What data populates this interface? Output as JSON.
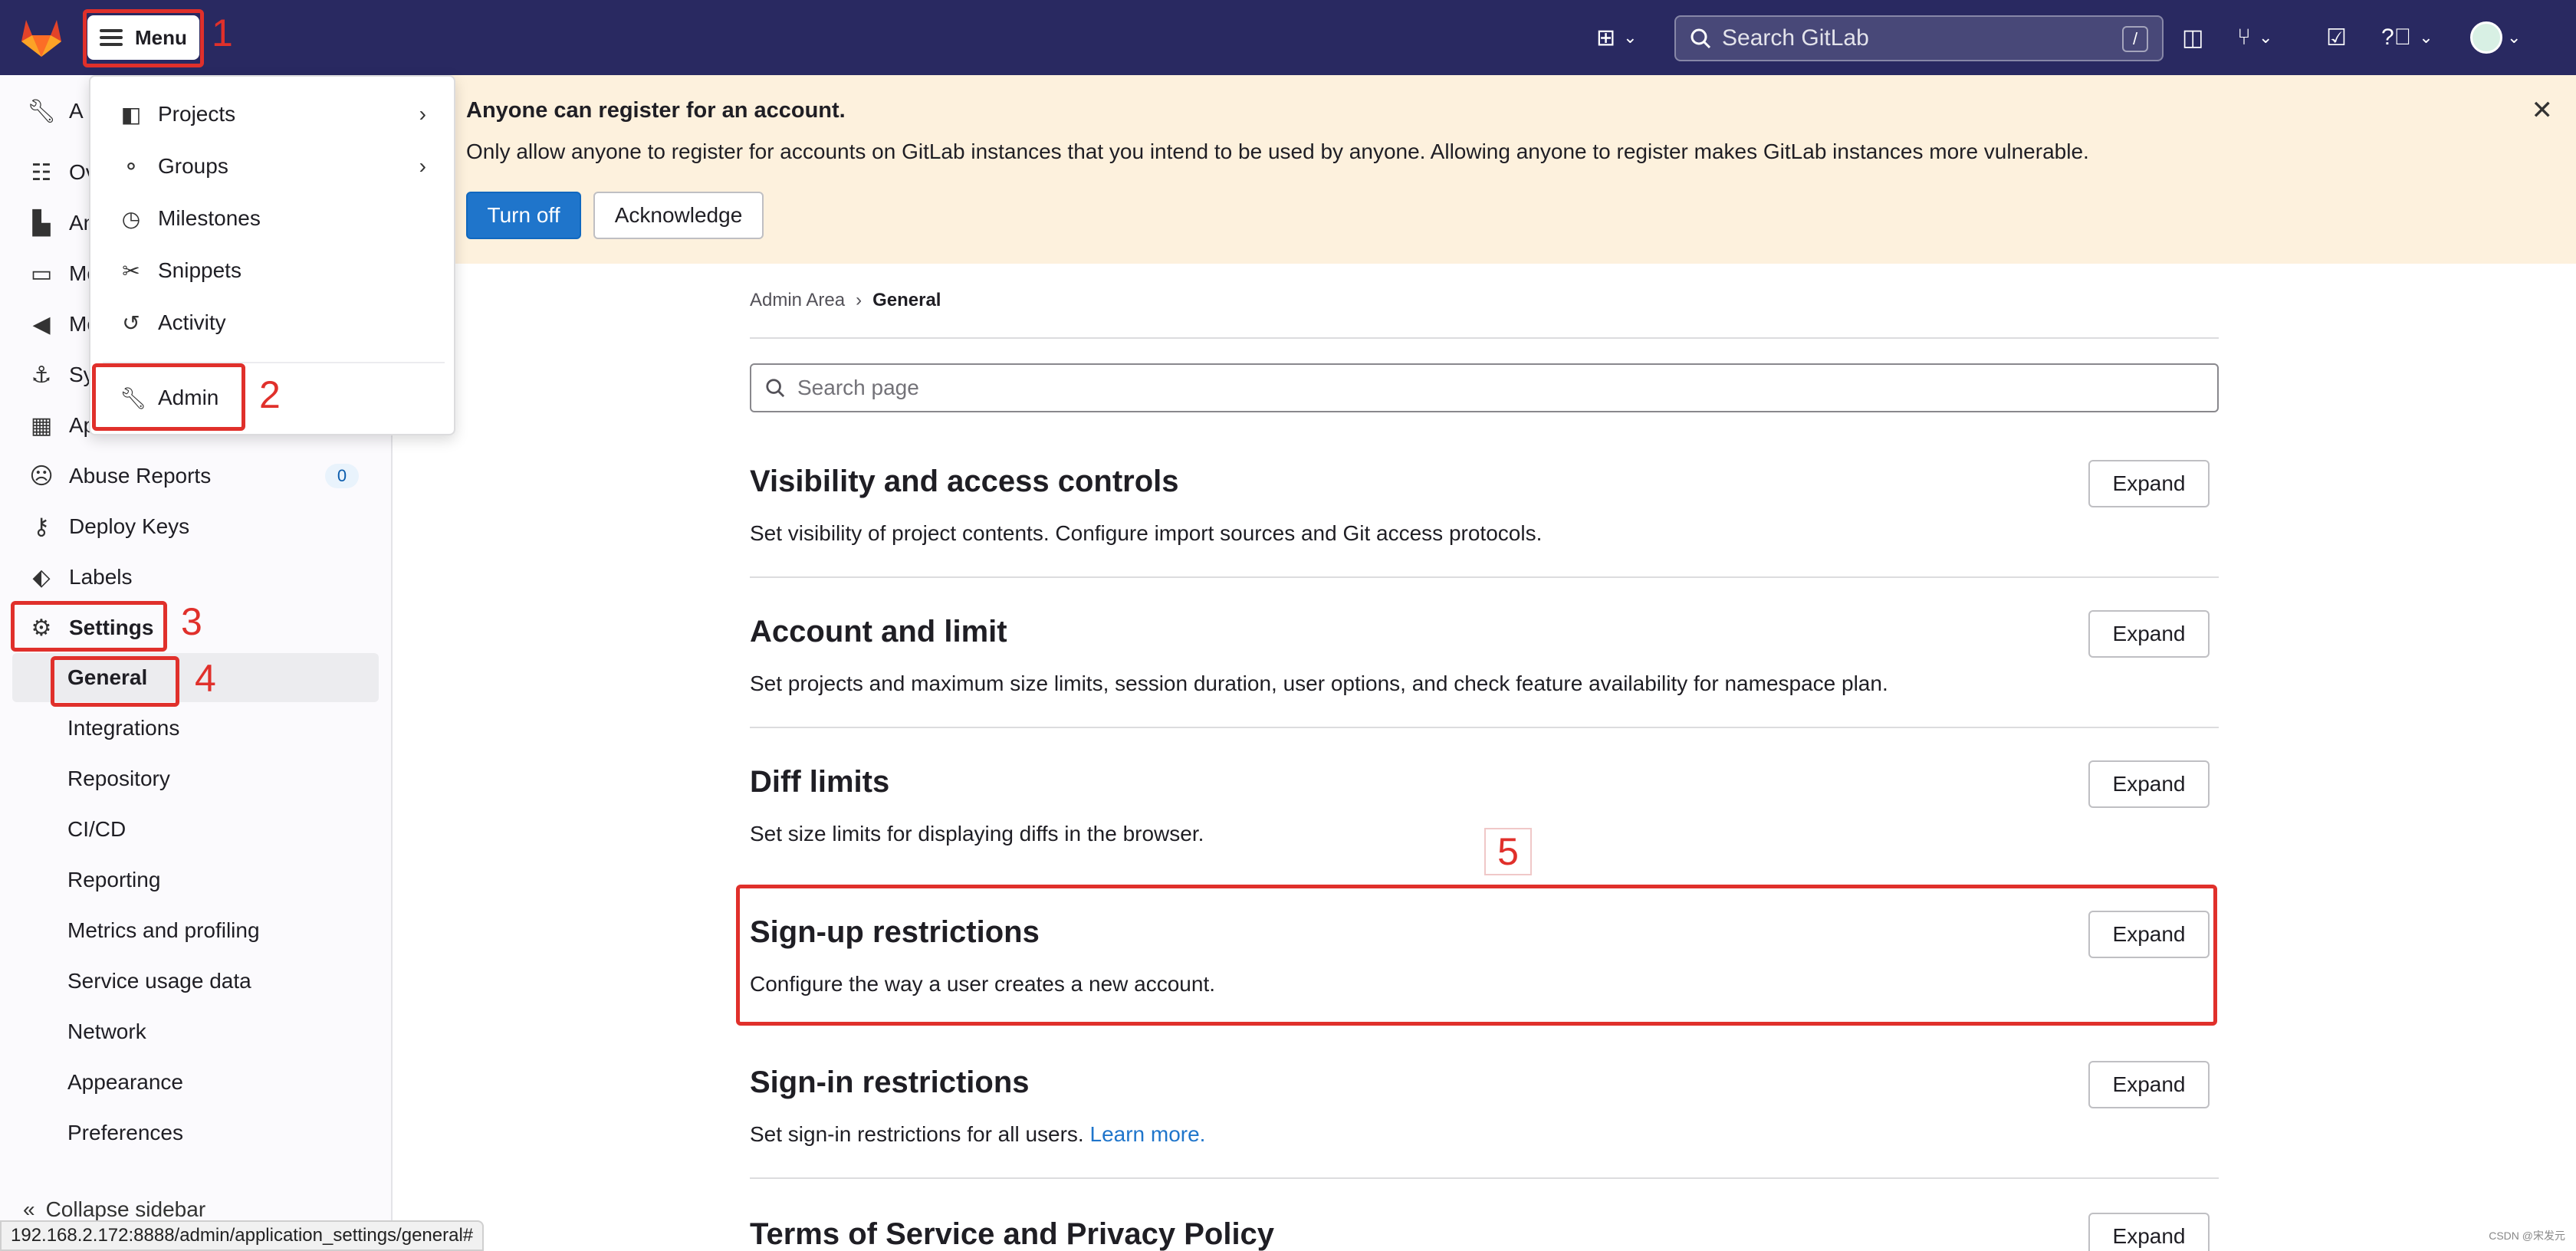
{
  "topbar": {
    "menu_label": "Menu",
    "search_placeholder": "Search GitLab",
    "search_shortcut": "/"
  },
  "dropdown": {
    "items": [
      {
        "label": "Projects",
        "icon": "project-icon",
        "has_submenu": true
      },
      {
        "label": "Groups",
        "icon": "group-icon",
        "has_submenu": true
      },
      {
        "label": "Milestones",
        "icon": "clock-icon",
        "has_submenu": false
      },
      {
        "label": "Snippets",
        "icon": "scissors-icon",
        "has_submenu": false
      },
      {
        "label": "Activity",
        "icon": "history-icon",
        "has_submenu": false
      }
    ],
    "admin_label": "Admin"
  },
  "sidebar": {
    "partial_labels": [
      "A",
      "Ov",
      "An",
      "Mo",
      "Me",
      "Sy",
      "Ap"
    ],
    "items": [
      {
        "label": "Abuse Reports",
        "badge": "0"
      },
      {
        "label": "Deploy Keys"
      },
      {
        "label": "Labels"
      },
      {
        "label": "Settings"
      }
    ],
    "settings_sub": [
      {
        "label": "General",
        "active": true
      },
      {
        "label": "Integrations"
      },
      {
        "label": "Repository"
      },
      {
        "label": "CI/CD"
      },
      {
        "label": "Reporting"
      },
      {
        "label": "Metrics and profiling"
      },
      {
        "label": "Service usage data"
      },
      {
        "label": "Network"
      },
      {
        "label": "Appearance"
      },
      {
        "label": "Preferences"
      }
    ],
    "collapse_label": "Collapse sidebar"
  },
  "banner": {
    "title": "Anyone can register for an account.",
    "body": "Only allow anyone to register for accounts on GitLab instances that you intend to be used by anyone. Allowing anyone to register makes GitLab instances more vulnerable.",
    "turn_off_label": "Turn off",
    "acknowledge_label": "Acknowledge"
  },
  "breadcrumb": {
    "parent": "Admin Area",
    "separator": "›",
    "current": "General"
  },
  "search_page": {
    "placeholder": "Search page"
  },
  "sections": [
    {
      "title": "Visibility and access controls",
      "desc": "Set visibility of project contents. Configure import sources and Git access protocols.",
      "expand": "Expand"
    },
    {
      "title": "Account and limit",
      "desc": "Set projects and maximum size limits, session duration, user options, and check feature availability for namespace plan.",
      "expand": "Expand"
    },
    {
      "title": "Diff limits",
      "desc": "Set size limits for displaying diffs in the browser.",
      "expand": "Expand"
    },
    {
      "title": "Sign-up restrictions",
      "desc": "Configure the way a user creates a new account.",
      "expand": "Expand"
    },
    {
      "title": "Sign-in restrictions",
      "desc": "Set sign-in restrictions for all users.",
      "link": "Learn more.",
      "expand": "Expand"
    },
    {
      "title": "Terms of Service and Privacy Policy",
      "desc": "",
      "expand": "Expand"
    }
  ],
  "annotations": [
    "1",
    "2",
    "3",
    "4",
    "5"
  ],
  "status_url": "192.168.2.172:8888/admin/application_settings/general#",
  "watermark": "CSDN @宋发元",
  "colors": {
    "topbar": "#292961",
    "banner": "#fdf1dd",
    "primary": "#1f75cb",
    "annotation": "#e0302b"
  }
}
